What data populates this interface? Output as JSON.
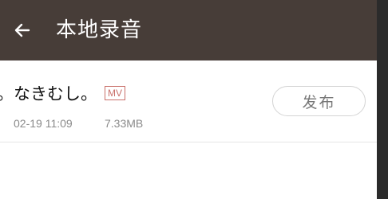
{
  "header": {
    "back_icon": "arrow-left-icon",
    "title": "本地录音"
  },
  "recording": {
    "title": "。なきむし。",
    "badge": "MV",
    "date": "02-19 11:09",
    "size": "7.33MB",
    "publish_label": "发布"
  },
  "colors": {
    "header_bg": "#473d38",
    "badge": "#c9706a",
    "meta_text": "#8a8a8a"
  }
}
